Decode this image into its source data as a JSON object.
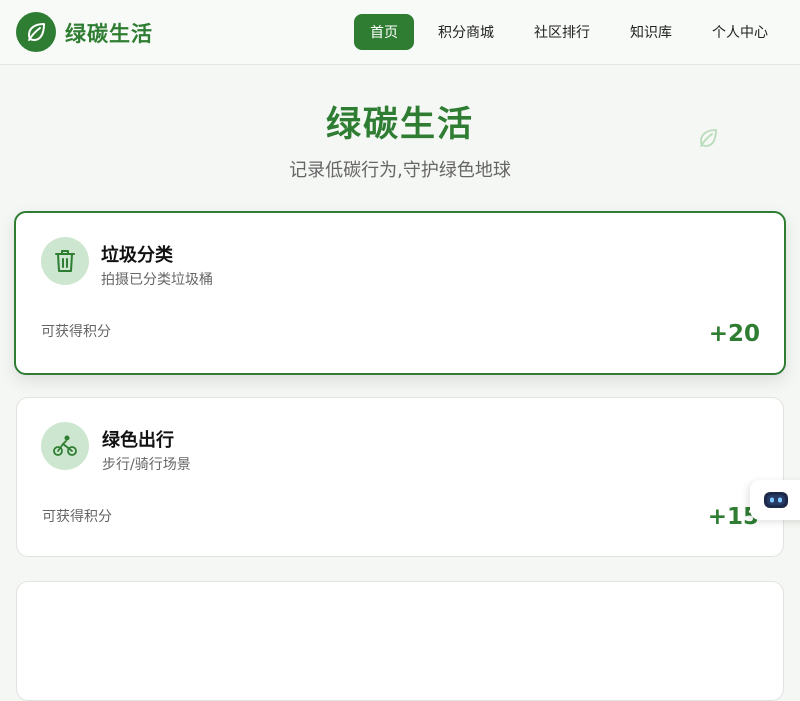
{
  "brand": {
    "name": "绿碳生活"
  },
  "nav": {
    "items": [
      {
        "label": "首页",
        "active": true
      },
      {
        "label": "积分商城",
        "active": false
      },
      {
        "label": "社区排行",
        "active": false
      },
      {
        "label": "知识库",
        "active": false
      },
      {
        "label": "个人中心",
        "active": false
      }
    ]
  },
  "hero": {
    "title": "绿碳生活",
    "subtitle": "记录低碳行为,守护绿色地球"
  },
  "activities": [
    {
      "title": "垃圾分类",
      "description": "拍摄已分类垃圾桶",
      "points_label": "可获得积分",
      "points": "+20",
      "icon": "trash-can-icon",
      "selected": true
    },
    {
      "title": "绿色出行",
      "description": "步行/骑行场景",
      "points_label": "可获得积分",
      "points": "+15",
      "icon": "bicycle-icon",
      "selected": false
    }
  ],
  "colors": {
    "primary": "#2e7d32",
    "icon_bg": "#cde6cf",
    "background": "#f5f7f4"
  }
}
